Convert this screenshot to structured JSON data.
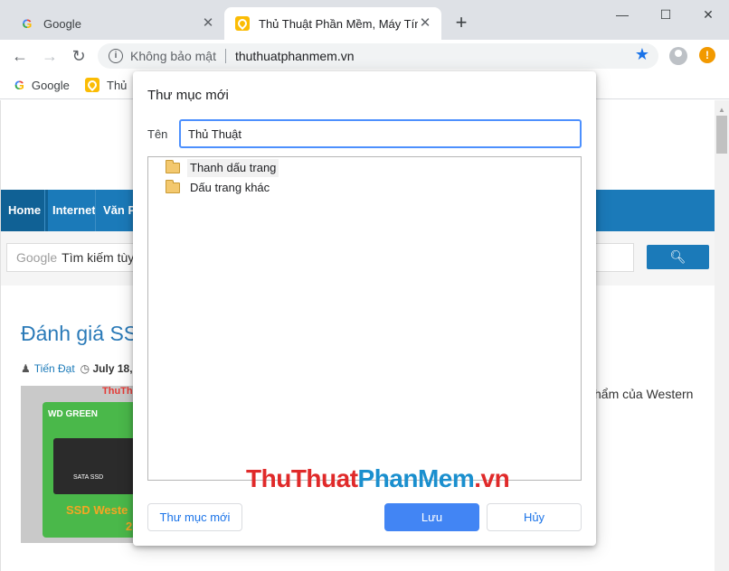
{
  "tabs": [
    {
      "title": "Google",
      "icon": "google-icon"
    },
    {
      "title": "Thủ Thuật Phần Mềm, Máy Tính, Thủ Thuật",
      "icon": "ttpm-icon"
    }
  ],
  "window_controls": {
    "minimize": "—",
    "maximize": "☐",
    "close": "✕"
  },
  "toolbar": {
    "security_text": "Không bảo mật",
    "url": "thuthuatphanmem.vn"
  },
  "bookmarks": [
    {
      "label": "Google",
      "icon": "google-icon"
    },
    {
      "label": "Thủ",
      "icon": "ttpm-icon"
    }
  ],
  "page": {
    "nav": [
      "Home",
      "Internet",
      "Văn Ph"
    ],
    "search_label": "Google",
    "search_placeholder": "Tìm kiếm tùy",
    "article_title": "Đánh giá SS",
    "author": "Tiến Đạt",
    "date": "July 18,",
    "side_text": "hẩm của Western",
    "image": {
      "brand": "WD GREEN",
      "drive_label": "SATA SSD",
      "caption": "SSD Weste",
      "caption2": "2",
      "mark": "ThuThu"
    }
  },
  "watermark": {
    "part1": "Thu",
    "part2": "Thuat",
    "part3": "PhanMem",
    "part4": ".vn"
  },
  "dialog": {
    "title": "Thư mục mới",
    "name_label": "Tên",
    "name_value": "Thủ Thuật",
    "folders": [
      {
        "label": "Thanh dấu trang",
        "selected": true
      },
      {
        "label": "Dấu trang khác",
        "selected": false
      }
    ],
    "buttons": {
      "new_folder": "Thư mục mới",
      "save": "Lưu",
      "cancel": "Hủy"
    }
  },
  "colors": {
    "accent": "#1a73e8",
    "site_blue": "#1b7ab9",
    "save_button": "#4285f4"
  }
}
